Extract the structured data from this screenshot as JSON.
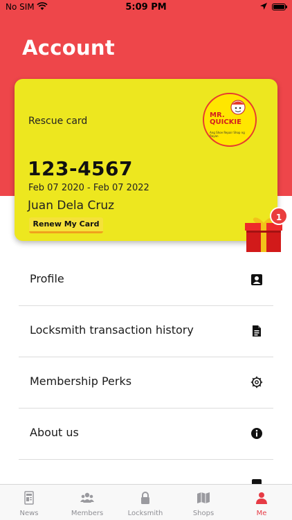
{
  "status_bar": {
    "carrier": "No SIM",
    "time": "5:09 PM"
  },
  "header": {
    "title": "Account"
  },
  "card": {
    "type": "Rescue card",
    "number": "123-4567",
    "dates": "Feb 07 2020 - Feb 07 2022",
    "holder": "Juan Dela Cruz",
    "renew_label": "Renew My Card",
    "logo": {
      "brand": "MR. QUICKIE",
      "tagline": "Ang Shoe Repair Shop ng Bayan"
    }
  },
  "gift": {
    "badge_count": "1",
    "icon": "gift-icon"
  },
  "menu": {
    "items": [
      {
        "label": "Profile",
        "icon": "profile-card-icon"
      },
      {
        "label": "Locksmith transaction history",
        "icon": "document-icon"
      },
      {
        "label": "Membership Perks",
        "icon": "gear-icon"
      },
      {
        "label": "About us",
        "icon": "info-icon"
      }
    ]
  },
  "tabbar": {
    "tabs": [
      {
        "label": "News",
        "icon": "news-icon",
        "active": false
      },
      {
        "label": "Members",
        "icon": "members-icon",
        "active": false
      },
      {
        "label": "Locksmith",
        "icon": "lock-icon",
        "active": false
      },
      {
        "label": "Shops",
        "icon": "map-icon",
        "active": false
      },
      {
        "label": "Me",
        "icon": "person-icon",
        "active": true
      }
    ]
  },
  "colors": {
    "brand_red": "#ee464a",
    "card_yellow": "#ede71f",
    "active_tab": "#e63b45"
  }
}
